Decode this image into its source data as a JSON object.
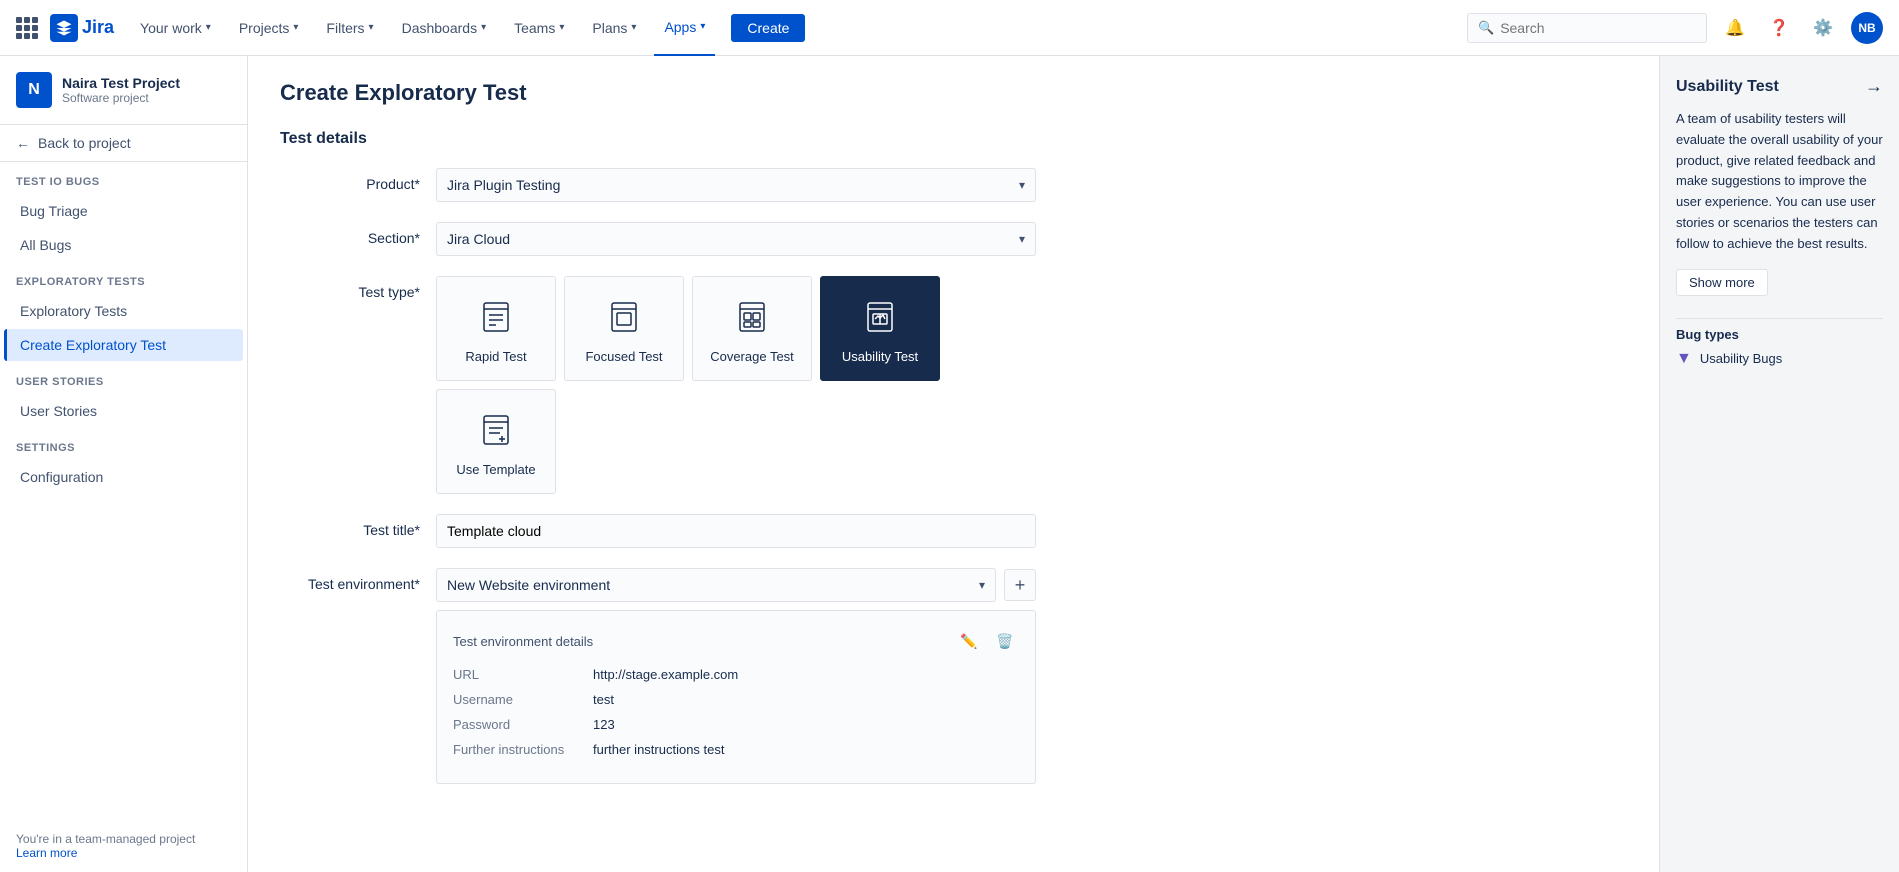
{
  "topnav": {
    "logo_text": "Jira",
    "nav_items": [
      {
        "label": "Your work",
        "has_chevron": true
      },
      {
        "label": "Projects",
        "has_chevron": true
      },
      {
        "label": "Filters",
        "has_chevron": true
      },
      {
        "label": "Dashboards",
        "has_chevron": true
      },
      {
        "label": "Teams",
        "has_chevron": true
      },
      {
        "label": "Plans",
        "has_chevron": true
      },
      {
        "label": "Apps",
        "has_chevron": true,
        "active": true
      }
    ],
    "create_label": "Create",
    "search_placeholder": "Search",
    "avatar_initials": "NB"
  },
  "sidebar": {
    "project_name": "Naira Test Project",
    "project_type": "Software project",
    "back_label": "Back to project",
    "sections": [
      {
        "title": "TEST IO BUGS",
        "items": [
          {
            "label": "Bug Triage",
            "active": false
          },
          {
            "label": "All Bugs",
            "active": false
          }
        ]
      },
      {
        "title": "EXPLORATORY TESTS",
        "items": [
          {
            "label": "Exploratory Tests",
            "active": false
          },
          {
            "label": "Create Exploratory Test",
            "active": true
          }
        ]
      },
      {
        "title": "USER STORIES",
        "items": [
          {
            "label": "User Stories",
            "active": false
          }
        ]
      },
      {
        "title": "SETTINGS",
        "items": [
          {
            "label": "Configuration",
            "active": false
          }
        ]
      }
    ],
    "footer_text": "You're in a team-managed project",
    "footer_link": "Learn more"
  },
  "content": {
    "page_title": "Create Exploratory Test",
    "section_title": "Test details",
    "form": {
      "product_label": "Product*",
      "product_value": "Jira Plugin Testing",
      "section_label": "Section*",
      "section_value": "Jira Cloud",
      "test_type_label": "Test type*",
      "test_title_label": "Test title*",
      "test_title_value": "Template cloud",
      "test_env_label": "Test environment*",
      "test_env_value": "New Website environment"
    },
    "test_types": [
      {
        "id": "rapid",
        "label": "Rapid Test",
        "selected": false
      },
      {
        "id": "focused",
        "label": "Focused Test",
        "selected": false
      },
      {
        "id": "coverage",
        "label": "Coverage Test",
        "selected": false
      },
      {
        "id": "usability",
        "label": "Usability Test",
        "selected": true
      },
      {
        "id": "template",
        "label": "Use Template",
        "selected": false
      }
    ],
    "env_details": {
      "title": "Test environment details",
      "fields": [
        {
          "key": "URL",
          "value": "http://stage.example.com"
        },
        {
          "key": "Username",
          "value": "test"
        },
        {
          "key": "Password",
          "value": "123"
        },
        {
          "key": "Further instructions",
          "value": "further instructions test"
        }
      ]
    }
  },
  "right_panel": {
    "title": "Usability Test",
    "description": "A team of usability testers will evaluate the overall usability of your product, give related feedback and make suggestions to improve the user experience. You can use user stories or scenarios the testers can follow to achieve the best results.",
    "show_more_label": "Show more",
    "bug_types_title": "Bug types",
    "bug_types": [
      {
        "label": "Usability Bugs"
      }
    ]
  }
}
